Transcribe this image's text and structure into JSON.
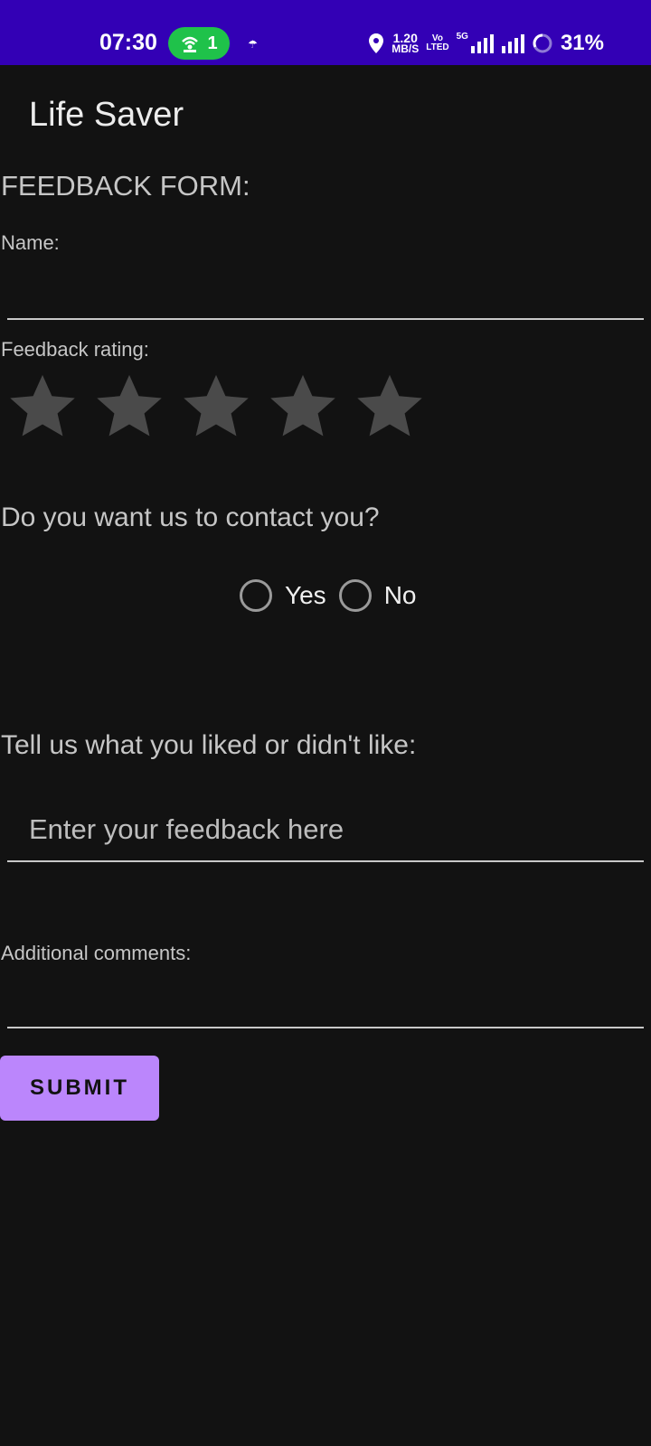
{
  "status_bar": {
    "time": "07:30",
    "hotspot_count": "1",
    "speed_value": "1.20",
    "speed_unit": "MB/S",
    "volte_top": "Vo",
    "volte_bottom": "LTED",
    "network_type": "5G",
    "battery": "31%"
  },
  "app": {
    "title": "Life Saver"
  },
  "form": {
    "heading": "FEEDBACK FORM:",
    "name_label": "Name:",
    "name_value": "",
    "rating_label": "Feedback rating:",
    "rating_value": 0,
    "rating_max": 5,
    "contact_question": "Do you want us to contact you?",
    "contact_options": [
      "Yes",
      "No"
    ],
    "liked_question": "Tell us what you liked or didn't like:",
    "feedback_placeholder": "Enter your feedback here",
    "additional_label": "Additional comments:",
    "additional_value": "",
    "submit_label": "SUBMIT"
  },
  "colors": {
    "status_bar": "#3300b5",
    "background": "#121212",
    "accent_button": "#bb86fc",
    "star_empty": "#4a4a4a",
    "hotspot_pill": "#1fc24a"
  }
}
